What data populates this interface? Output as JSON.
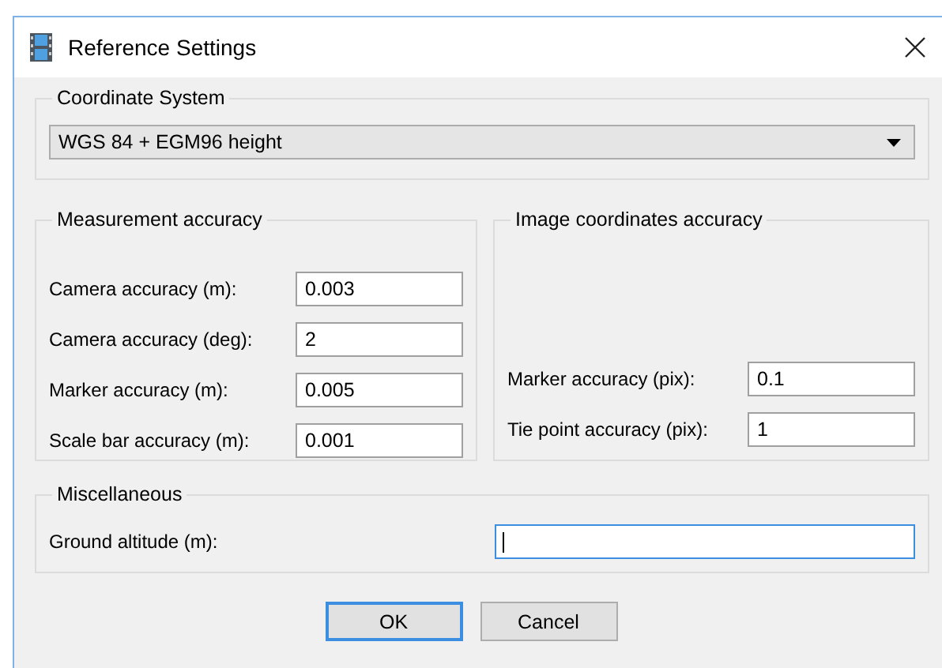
{
  "window": {
    "title": "Reference Settings"
  },
  "coordinate_system": {
    "title": "Coordinate System",
    "value": "WGS 84 + EGM96 height"
  },
  "measurement_accuracy": {
    "title": "Measurement accuracy",
    "fields": [
      {
        "label": "Camera accuracy (m):",
        "value": "0.003",
        "focused": false
      },
      {
        "label": "Camera accuracy (deg):",
        "value": "2",
        "focused": false
      },
      {
        "label": "Marker accuracy (m):",
        "value": "0.005",
        "focused": false
      },
      {
        "label": "Scale bar accuracy (m):",
        "value": "0.001",
        "focused": false
      }
    ]
  },
  "image_coordinates_accuracy": {
    "title": "Image coordinates accuracy",
    "fields": [
      {
        "label": "Marker accuracy (pix):",
        "value": "0.1",
        "focused": false
      },
      {
        "label": "Tie point accuracy (pix):",
        "value": "1",
        "focused": false
      }
    ]
  },
  "miscellaneous": {
    "title": "Miscellaneous",
    "fields": [
      {
        "label": "Ground altitude (m):",
        "focused": true
      }
    ]
  },
  "buttons": [
    {
      "label": "OK",
      "default": true
    },
    {
      "label": "Cancel",
      "default": false
    }
  ]
}
